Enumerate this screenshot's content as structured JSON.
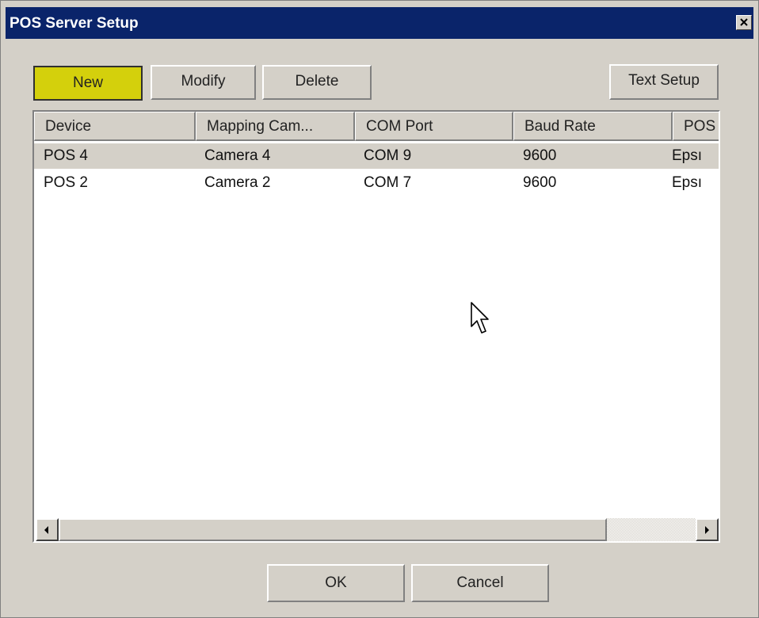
{
  "window": {
    "title": "POS Server Setup",
    "close_icon": "close-icon"
  },
  "toolbar": {
    "new_label": "New",
    "modify_label": "Modify",
    "delete_label": "Delete",
    "text_setup_label": "Text Setup"
  },
  "colors": {
    "title_bar": "#0a246a",
    "new_button": "#d4d00c",
    "window_bg": "#d4d0c8",
    "selected_row": "#d4d0c8"
  },
  "table": {
    "columns": [
      "Device",
      "Mapping Cam...",
      "COM Port",
      "Baud Rate",
      "POS"
    ],
    "rows": [
      [
        "POS 4",
        "Camera 4",
        "COM 9",
        "9600",
        "Epsı"
      ],
      [
        "POS 2",
        "Camera 2",
        "COM 7",
        "9600",
        "Epsı"
      ]
    ],
    "selected_row": 0
  },
  "scrollbar": {
    "left_icon": "arrow-left-icon",
    "right_icon": "arrow-right-icon"
  },
  "footer": {
    "ok_label": "OK",
    "cancel_label": "Cancel"
  }
}
